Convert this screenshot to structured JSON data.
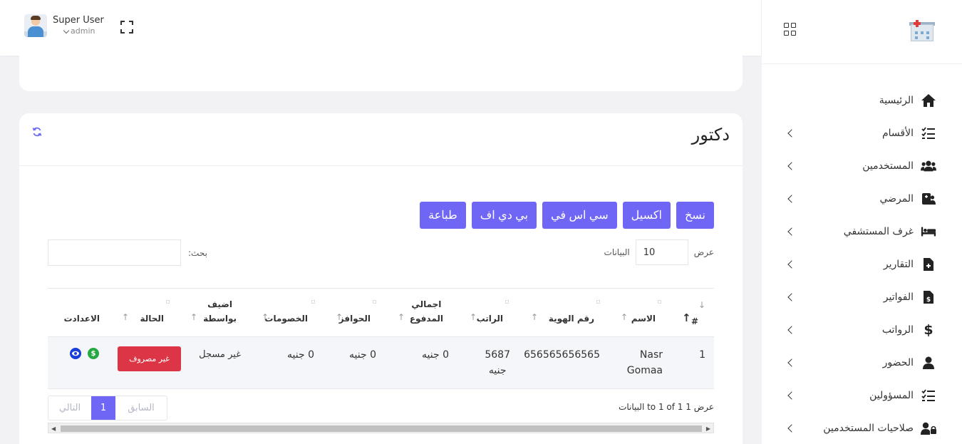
{
  "header": {
    "user_name": "Super User",
    "user_role": "admin"
  },
  "sidebar": {
    "items": [
      {
        "label": "الرئيسية",
        "icon": "home-icon",
        "glyph": "⌂",
        "has_submenu": false
      },
      {
        "label": "الأقسام",
        "icon": "checklist-icon",
        "glyph": "☰",
        "has_submenu": true
      },
      {
        "label": "المستخدمين",
        "icon": "users-icon",
        "glyph": "👥",
        "has_submenu": true
      },
      {
        "label": "المرضي",
        "icon": "patient-icon",
        "glyph": "▦",
        "has_submenu": true
      },
      {
        "label": "غرف المستشفي",
        "icon": "bed-icon",
        "glyph": "▬",
        "has_submenu": true
      },
      {
        "label": "التقارير",
        "icon": "file-medical-icon",
        "glyph": "▤",
        "has_submenu": true
      },
      {
        "label": "الفواتير",
        "icon": "invoice-icon",
        "glyph": "▤",
        "has_submenu": true
      },
      {
        "label": "الرواتب",
        "icon": "dollar-icon",
        "glyph": "$",
        "has_submenu": true
      },
      {
        "label": "الحضور",
        "icon": "user-icon",
        "glyph": "●",
        "has_submenu": true
      },
      {
        "label": "المسؤولين",
        "icon": "checklist-icon",
        "glyph": "☰",
        "has_submenu": true
      },
      {
        "label": "صلاحيات المستخدمين",
        "icon": "user-lock-icon",
        "glyph": "●",
        "has_submenu": true
      }
    ]
  },
  "page": {
    "title": "دكتور",
    "buttons": {
      "copy": "نسخ",
      "excel": "اكسيل",
      "csv": "سي اس في",
      "pdf": "بي دي اف",
      "print": "طباعة"
    },
    "length_prefix": "عرض",
    "length_value": "10",
    "length_suffix": "البيانات",
    "search_label": "بحث:",
    "search_value": ""
  },
  "table": {
    "headers": {
      "num": "#",
      "name": "الاسم",
      "national_id": "رقم الهوية",
      "salary": "الراتب",
      "total_paid_1": "اجمالي",
      "total_paid_2": "المدفوع",
      "incentives": "الحوافز",
      "deductions": "الخصومات",
      "added_by_1": "اضيف",
      "added_by_2": "بواسطة",
      "status": "الحالة",
      "settings": "الاعدادت"
    },
    "rows": [
      {
        "num": "1",
        "name_1": "Nasr",
        "name_2": "Gomaa",
        "national_id": "656565656565",
        "salary_1": "5687",
        "salary_2": "جنيه",
        "total_paid": "0 جنيه",
        "incentives": "0 جنيه",
        "deductions": "0 جنيه",
        "added_by": "غير مسجل",
        "status": "غير مصروف"
      }
    ]
  },
  "footer": {
    "info": "عرض 1 to 1 of 1 البيانات",
    "prev": "السابق",
    "page": "1",
    "next": "التالي"
  },
  "colors": {
    "accent": "#7066f6",
    "danger": "#dc3545",
    "success": "#28a745",
    "info": "#1a3fd9"
  }
}
